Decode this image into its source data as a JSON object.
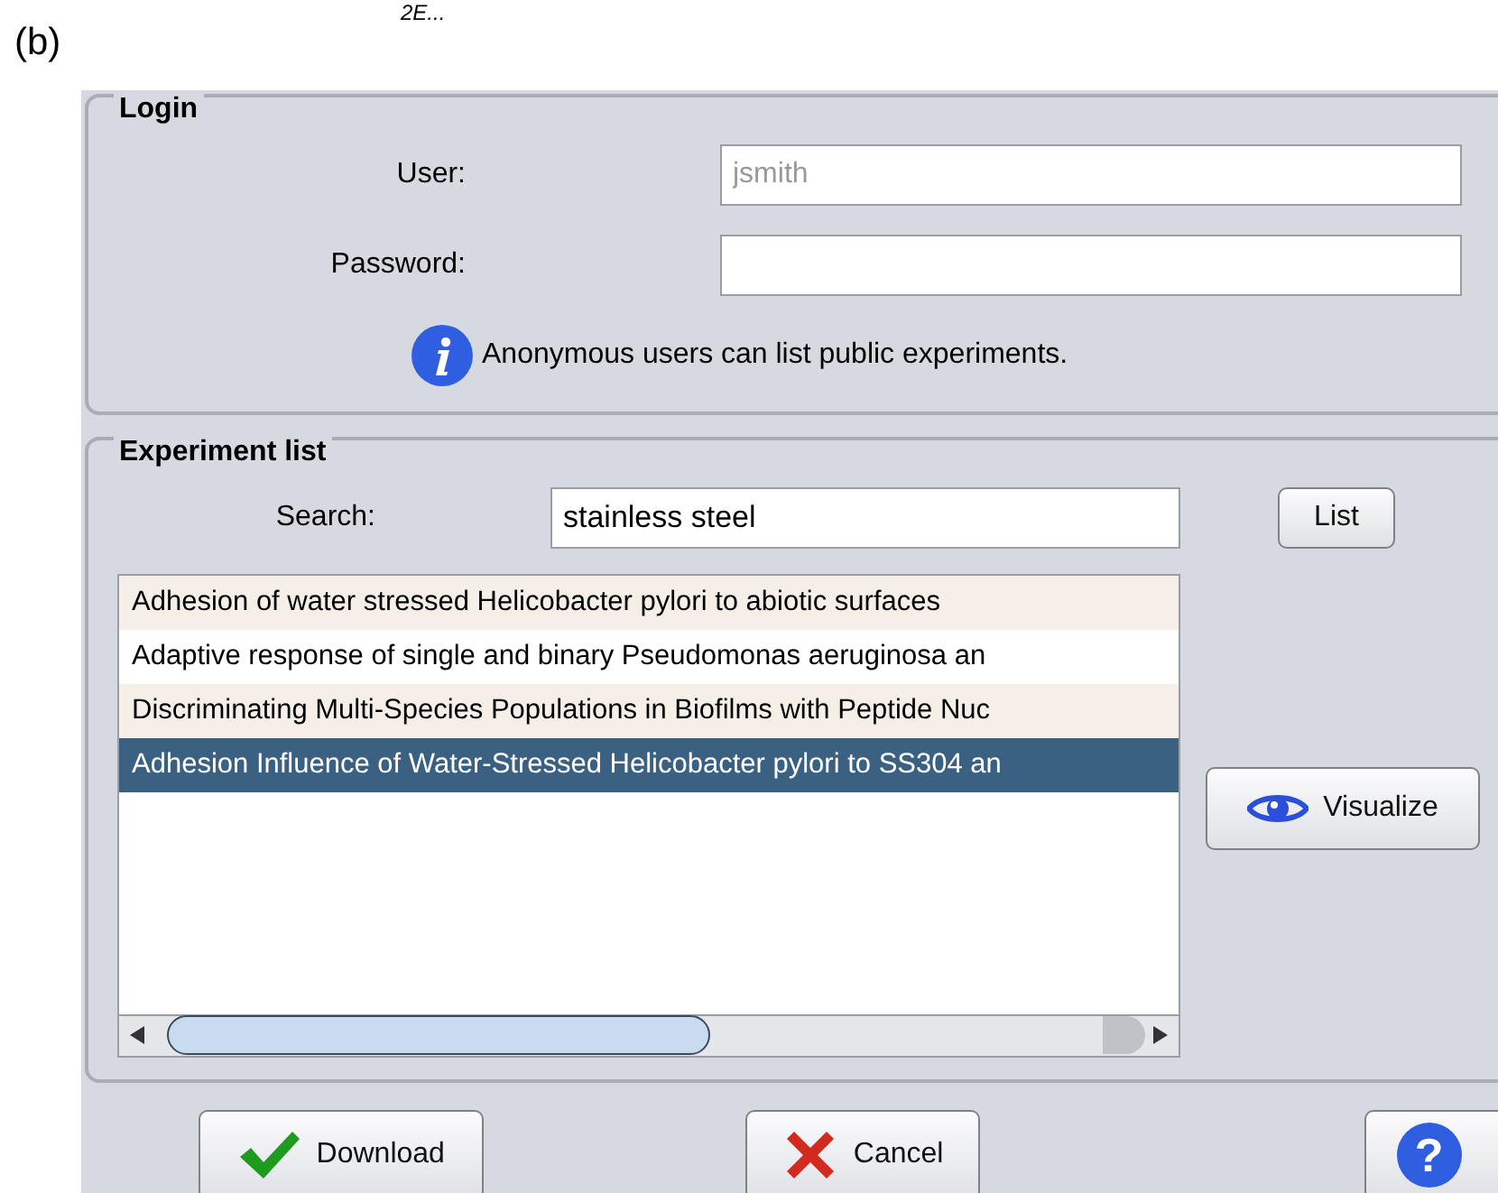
{
  "figure_label": "(b)",
  "caption_fragment": "2E...",
  "login": {
    "title": "Login",
    "fields": [
      {
        "label": "User:",
        "placeholder": "jsmith"
      },
      {
        "label": "Password:"
      }
    ],
    "info": "Anonymous users can list public experiments."
  },
  "experiments": {
    "title": "Experiment list",
    "search": {
      "label": "Search:",
      "value": "stainless steel"
    },
    "list_button": "List",
    "visualize_button": "Visualize",
    "rows": [
      {
        "title": "Adhesion of water stressed Helicobacter pylori to abiotic surfaces",
        "selected": false
      },
      {
        "title": "Adaptive response of single and binary Pseudomonas aeruginosa an",
        "selected": false
      },
      {
        "title": "Discriminating Multi-Species Populations in Biofilms with Peptide Nuc",
        "selected": false
      },
      {
        "title": "Adhesion Influence of Water-Stressed Helicobacter pylori to SS304 an",
        "selected": true
      }
    ]
  },
  "buttons": [
    {
      "kind": "download",
      "label": "Download"
    },
    {
      "kind": "cancel",
      "label": "Cancel"
    },
    {
      "kind": "help",
      "label": "?"
    }
  ]
}
